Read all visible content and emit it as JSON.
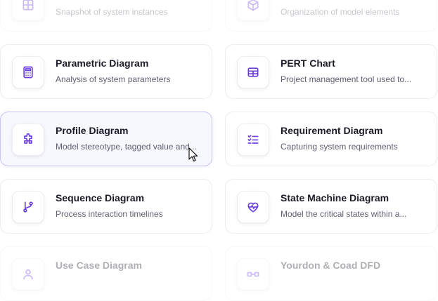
{
  "accent_color": "#6d3fe0",
  "cards": [
    {
      "title": "",
      "description": "Snapshot of system instances",
      "icon": "grid-icon"
    },
    {
      "title": "",
      "description": "Organization of model elements",
      "icon": "package-icon"
    },
    {
      "title": "Parametric Diagram",
      "description": "Analysis of system parameters",
      "icon": "calculator-icon"
    },
    {
      "title": "PERT Chart",
      "description": "Project management tool used to...",
      "icon": "table-icon"
    },
    {
      "title": "Profile Diagram",
      "description": "Model stereotype, tagged value and...",
      "icon": "puzzle-icon"
    },
    {
      "title": "Requirement Diagram",
      "description": "Capturing system requirements",
      "icon": "checklist-icon"
    },
    {
      "title": "Sequence Diagram",
      "description": "Process interaction timelines",
      "icon": "git-branch-icon"
    },
    {
      "title": "State Machine Diagram",
      "description": "Model the critical states within a...",
      "icon": "heart-pulse-icon"
    },
    {
      "title": "Use Case Diagram",
      "description": "",
      "icon": "user-icon"
    },
    {
      "title": "Yourdon & Coad DFD",
      "description": "",
      "icon": "flow-icon"
    }
  ]
}
